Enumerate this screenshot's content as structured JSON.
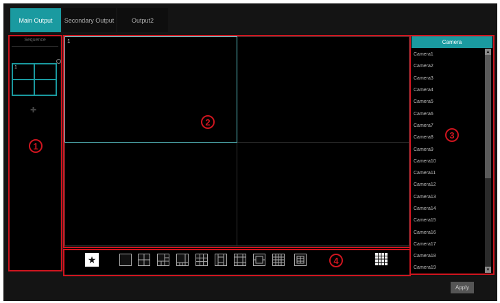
{
  "tabs": [
    {
      "label": "Main Output",
      "active": true
    },
    {
      "label": "Secondary Output",
      "active": false
    },
    {
      "label": "Output2",
      "active": false
    }
  ],
  "sequence": {
    "label": "Sequence",
    "grid_cells": [
      "1",
      "",
      "",
      ""
    ]
  },
  "preview": {
    "cells": [
      "1",
      "",
      "",
      ""
    ]
  },
  "camera_panel": {
    "header": "Camera",
    "items": [
      "Camera1",
      "Camera2",
      "Camera3",
      "Camera4",
      "Camera5",
      "Camera6",
      "Camera7",
      "Camera8",
      "Camera9",
      "Camera10",
      "Camera11",
      "Camera12",
      "Camera13",
      "Camera14",
      "Camera15",
      "Camera16",
      "Camera17",
      "Camera18",
      "Camera19"
    ]
  },
  "markers": [
    "1",
    "2",
    "3",
    "4"
  ],
  "toolbar": {
    "favorite_icon": "star-icon",
    "layouts": [
      "layout-1",
      "layout-4",
      "layout-6",
      "layout-8",
      "layout-9",
      "layout-10",
      "layout-13",
      "layout-14",
      "layout-16",
      "layout-25"
    ],
    "more_icon": "more-layouts-icon"
  },
  "apply_label": "Apply",
  "colors": {
    "accent": "#1a9aa0",
    "annotation": "#d0151f",
    "background": "#141414"
  }
}
